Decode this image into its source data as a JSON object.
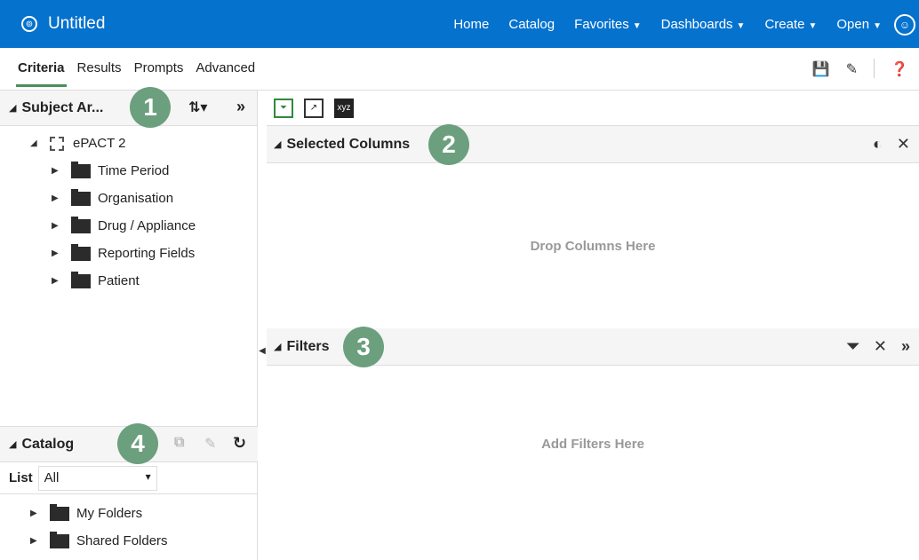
{
  "app": {
    "title": "Untitled",
    "nav": [
      {
        "label": "Home"
      },
      {
        "label": "Catalog"
      },
      {
        "label": "Favorites"
      },
      {
        "label": "Dashboards"
      },
      {
        "label": "Create"
      },
      {
        "label": "Open"
      }
    ]
  },
  "tabs": [
    {
      "label": "Criteria",
      "active": true
    },
    {
      "label": "Results",
      "active": false
    },
    {
      "label": "Prompts",
      "active": false
    },
    {
      "label": "Advanced",
      "active": false
    }
  ],
  "left": {
    "subject_area": {
      "title": "Subject Ar...",
      "badge": "1",
      "tree_root": "ePACT 2",
      "folders": [
        "Time Period",
        "Organisation",
        "Drug / Appliance",
        "Reporting Fields",
        "Patient"
      ]
    },
    "catalog": {
      "title": "Catalog",
      "badge": "4",
      "list_label": "List",
      "list_value": "All",
      "folders": [
        "My Folders",
        "Shared Folders"
      ]
    }
  },
  "main": {
    "toolbar": {
      "filter_icon": "filter-icon",
      "chart_icon": "chart-icon",
      "xyz_label": "xyz"
    },
    "selected_columns": {
      "title": "Selected Columns",
      "badge": "2",
      "placeholder": "Drop Columns Here"
    },
    "filters": {
      "title": "Filters",
      "badge": "3",
      "placeholder": "Add Filters Here"
    }
  }
}
